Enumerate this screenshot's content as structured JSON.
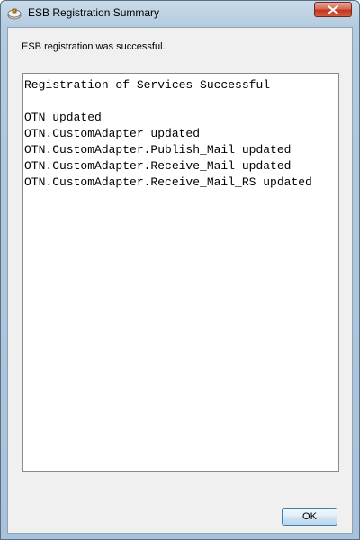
{
  "window": {
    "title": "ESB Registration Summary",
    "app_icon": "registration-icon",
    "close_icon": "close-icon"
  },
  "message": "ESB registration was successful.",
  "log": {
    "lines": [
      "Registration of Services Successful",
      "",
      "OTN updated",
      "OTN.CustomAdapter updated",
      "OTN.CustomAdapter.Publish_Mail updated",
      "OTN.CustomAdapter.Receive_Mail updated",
      "OTN.CustomAdapter.Receive_Mail_RS updated"
    ]
  },
  "buttons": {
    "ok_label": "OK"
  },
  "colors": {
    "close_button": "#c0391f",
    "title_bar": "#b3cadf",
    "dialog_face": "#f0f0f0"
  }
}
